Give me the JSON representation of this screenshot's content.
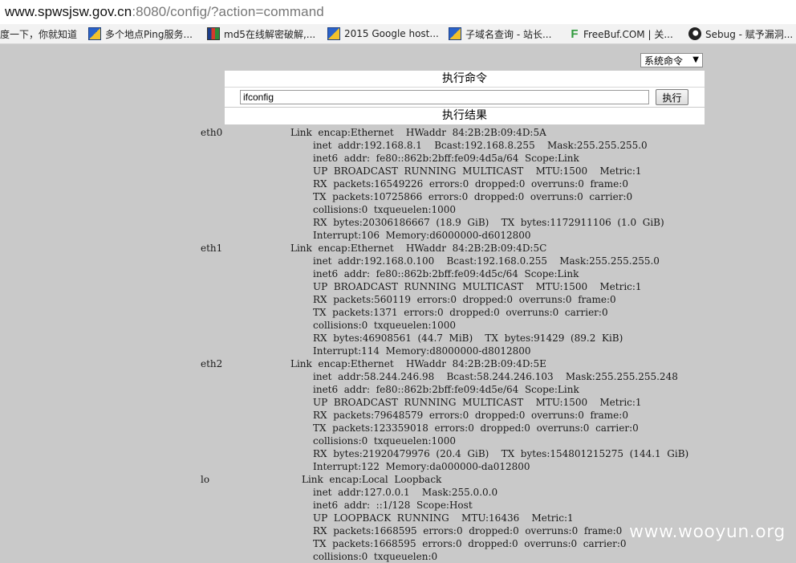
{
  "address_bar": {
    "host": "www.spwsjsw.gov.cn",
    "rest": ":8080/config/?action=command"
  },
  "bookmarks": [
    {
      "label": "度一下，你就知道",
      "icon": "none"
    },
    {
      "label": "多个地点Ping服务...",
      "icon": "ping-icon"
    },
    {
      "label": "md5在线解密破解,...",
      "icon": "md5-icon"
    },
    {
      "label": "2015 Google host...",
      "icon": "google-hosts-icon"
    },
    {
      "label": "子域名查询 - 站长...",
      "icon": "subdomain-icon"
    },
    {
      "label": "FreeBuf.COM | 关...",
      "icon": "freebuf-icon"
    },
    {
      "label": "Sebug - 赋予漏洞...",
      "icon": "sebug-icon"
    }
  ],
  "page": {
    "select_value": "系统命令",
    "exec_title": "执行命令",
    "command_value": "ifconfig",
    "exec_button": "执行",
    "result_title": "执行结果"
  },
  "results": [
    {
      "name": "eth0",
      "link": "Link  encap:Ethernet    HWaddr  84:2B:2B:09:4D:5A",
      "lines": [
        "inet  addr:192.168.8.1    Bcast:192.168.8.255    Mask:255.255.255.0",
        "inet6  addr:  fe80::862b:2bff:fe09:4d5a/64  Scope:Link",
        "UP  BROADCAST  RUNNING  MULTICAST    MTU:1500    Metric:1",
        "RX  packets:16549226  errors:0  dropped:0  overruns:0  frame:0",
        "TX  packets:10725866  errors:0  dropped:0  overruns:0  carrier:0",
        "collisions:0  txqueuelen:1000",
        "RX  bytes:20306186667  (18.9  GiB)    TX  bytes:1172911106  (1.0  GiB)",
        "Interrupt:106  Memory:d6000000-d6012800"
      ]
    },
    {
      "name": "eth1",
      "link": "Link  encap:Ethernet    HWaddr  84:2B:2B:09:4D:5C",
      "lines": [
        "inet  addr:192.168.0.100    Bcast:192.168.0.255    Mask:255.255.255.0",
        "inet6  addr:  fe80::862b:2bff:fe09:4d5c/64  Scope:Link",
        "UP  BROADCAST  RUNNING  MULTICAST    MTU:1500    Metric:1",
        "RX  packets:560119  errors:0  dropped:0  overruns:0  frame:0",
        "TX  packets:1371  errors:0  dropped:0  overruns:0  carrier:0",
        "collisions:0  txqueuelen:1000",
        "RX  bytes:46908561  (44.7  MiB)    TX  bytes:91429  (89.2  KiB)",
        "Interrupt:114  Memory:d8000000-d8012800"
      ]
    },
    {
      "name": "eth2",
      "link": "Link  encap:Ethernet    HWaddr  84:2B:2B:09:4D:5E",
      "lines": [
        "inet  addr:58.244.246.98    Bcast:58.244.246.103    Mask:255.255.255.248",
        "inet6  addr:  fe80::862b:2bff:fe09:4d5e/64  Scope:Link",
        "UP  BROADCAST  RUNNING  MULTICAST    MTU:1500    Metric:1",
        "RX  packets:79648579  errors:0  dropped:0  overruns:0  frame:0",
        "TX  packets:123359018  errors:0  dropped:0  overruns:0  carrier:0",
        "collisions:0  txqueuelen:1000",
        "RX  bytes:21920479976  (20.4  GiB)    TX  bytes:154801215275  (144.1  GiB)",
        "Interrupt:122  Memory:da000000-da012800"
      ]
    },
    {
      "name": "lo",
      "link": "Link  encap:Local  Loopback",
      "lines": [
        "inet  addr:127.0.0.1    Mask:255.0.0.0",
        "inet6  addr:  ::1/128  Scope:Host",
        "UP  LOOPBACK  RUNNING    MTU:16436    Metric:1",
        "RX  packets:1668595  errors:0  dropped:0  overruns:0  frame:0",
        "TX  packets:1668595  errors:0  dropped:0  overruns:0  carrier:0",
        "collisions:0  txqueuelen:0"
      ]
    }
  ],
  "watermark": "www.wooyun.org"
}
